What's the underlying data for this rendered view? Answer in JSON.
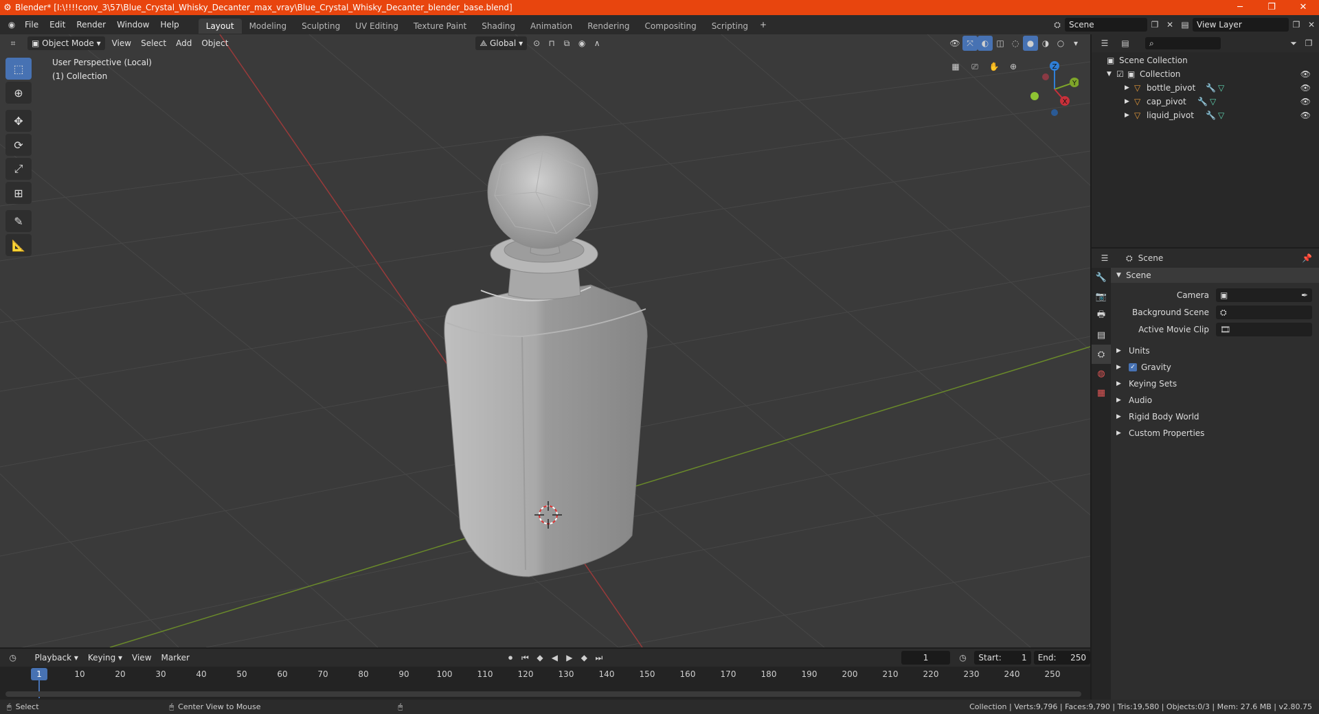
{
  "titlebar": {
    "title": "Blender* [I:\\!!!!conv_3\\57\\Blue_Crystal_Whisky_Decanter_max_vray\\Blue_Crystal_Whisky_Decanter_blender_base.blend]",
    "minimize": "─",
    "maximize": "❐",
    "close": "✕"
  },
  "menu": [
    "File",
    "Edit",
    "Render",
    "Window",
    "Help"
  ],
  "workspaces": [
    {
      "label": "Layout",
      "active": true
    },
    {
      "label": "Modeling"
    },
    {
      "label": "Sculpting"
    },
    {
      "label": "UV Editing"
    },
    {
      "label": "Texture Paint"
    },
    {
      "label": "Shading"
    },
    {
      "label": "Animation"
    },
    {
      "label": "Rendering"
    },
    {
      "label": "Compositing"
    },
    {
      "label": "Scripting"
    }
  ],
  "scene_field": "Scene",
  "view_layer_field": "View Layer",
  "viewport_header": {
    "mode": "Object Mode",
    "menus": [
      "View",
      "Select",
      "Add",
      "Object"
    ],
    "orientation": "Global"
  },
  "viewport": {
    "perspective_label": "User Perspective (Local)",
    "collection_label": "(1) Collection",
    "gizmo_x": "X",
    "gizmo_y": "Y",
    "gizmo_z": "Z"
  },
  "outliner": {
    "root": "Scene Collection",
    "collection": "Collection",
    "objects": [
      "bottle_pivot",
      "cap_pivot",
      "liquid_pivot"
    ]
  },
  "properties": {
    "header": "Scene",
    "panel": "Scene",
    "camera_label": "Camera",
    "background_scene_label": "Background Scene",
    "active_movie_clip_label": "Active Movie Clip",
    "subpanels": [
      "Units",
      "Gravity",
      "Keying Sets",
      "Audio",
      "Rigid Body World",
      "Custom Properties"
    ]
  },
  "timeline": {
    "menus": [
      "Playback",
      "Keying",
      "View",
      "Marker"
    ],
    "current_frame": "1",
    "start_label": "Start:",
    "start": "1",
    "end_label": "End:",
    "end": "250",
    "ticks": [
      "1",
      "10",
      "20",
      "30",
      "40",
      "50",
      "60",
      "70",
      "80",
      "90",
      "100",
      "110",
      "120",
      "130",
      "140",
      "150",
      "160",
      "170",
      "180",
      "190",
      "200",
      "210",
      "220",
      "230",
      "240",
      "250"
    ]
  },
  "statusbar": {
    "select": "Select",
    "center_view": "Center View to Mouse",
    "stats": "Collection | Verts:9,796 | Faces:9,790 | Tris:19,580 | Objects:0/3 | Mem: 27.6 MB | v2.80.75"
  },
  "colors": {
    "titlebar": "#e8450e",
    "accent": "#4772b3",
    "x_axis": "#c8303a",
    "y_axis": "#7ea52a",
    "z_axis": "#2f7fd8"
  }
}
